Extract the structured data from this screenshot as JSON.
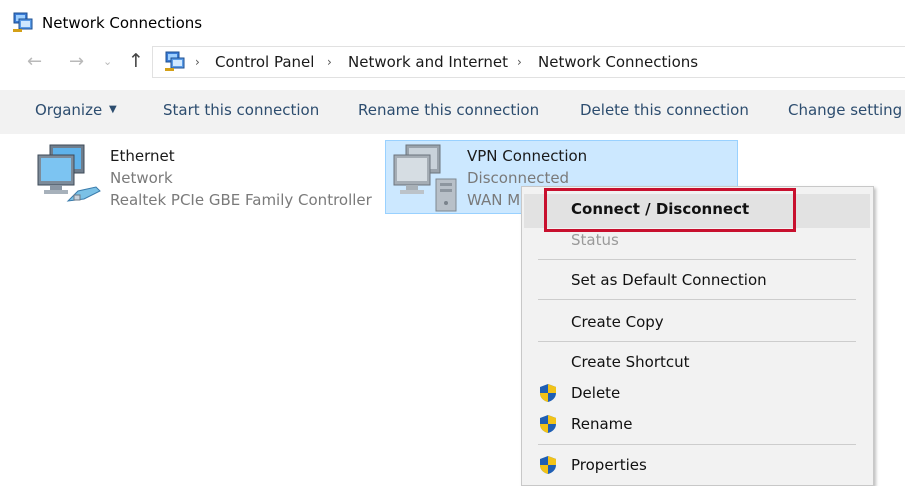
{
  "window": {
    "title": "Network Connections"
  },
  "address_bar": {
    "back_glyph": "←",
    "forward_glyph": "→",
    "dropdown_glyph": "⌄",
    "up_glyph": "↑",
    "separator_glyph": "›",
    "breadcrumbs": [
      "Control Panel",
      "Network and Internet",
      "Network Connections"
    ]
  },
  "toolbar": {
    "organize_label": "Organize",
    "organize_caret": "▼",
    "start_label": "Start this connection",
    "rename_label": "Rename this connection",
    "delete_label": "Delete this connection",
    "change_label": "Change setting"
  },
  "connections": [
    {
      "name": "Ethernet",
      "status": "Network",
      "device": "Realtek PCIe GBE Family Controller",
      "icon": "ethernet-adapter-icon"
    },
    {
      "name": "VPN Connection",
      "status": "Disconnected",
      "device": "WAN M",
      "icon": "vpn-adapter-icon",
      "selected": true
    }
  ],
  "context_menu": {
    "items": [
      {
        "label": "Connect / Disconnect",
        "bold": true,
        "highlighted": true
      },
      {
        "label": "Status",
        "disabled": true
      },
      {
        "label": "Set as Default Connection"
      },
      {
        "label": "Create Copy"
      },
      {
        "label": "Create Shortcut"
      },
      {
        "label": "Delete",
        "icon": "uac-shield-icon"
      },
      {
        "label": "Rename",
        "icon": "uac-shield-icon"
      },
      {
        "label": "Properties",
        "icon": "uac-shield-icon"
      }
    ],
    "annotation_color": "#c8102e"
  },
  "colors": {
    "toolbar_bg": "#f2f2f2",
    "toolbar_text": "#2d4d6f",
    "selection_bg": "#cce8ff",
    "selection_border": "#99d1ff",
    "menu_bg": "#f2f2f2",
    "shield_blue": "#1f5fb4",
    "shield_yellow": "#f2c318"
  }
}
